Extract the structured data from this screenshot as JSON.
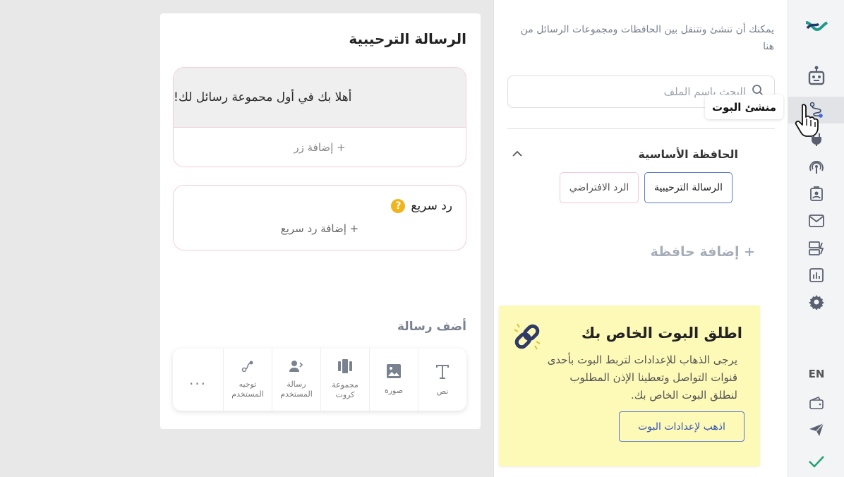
{
  "rail": {
    "items": [
      {
        "icon": "logo-icon"
      },
      {
        "icon": "robot-icon"
      },
      {
        "icon": "bot-builder-icon",
        "active": true
      },
      {
        "icon": "plug-icon"
      },
      {
        "icon": "broadcast-icon"
      },
      {
        "icon": "contacts-icon"
      },
      {
        "icon": "mail-icon"
      },
      {
        "icon": "ads-icon"
      },
      {
        "icon": "analytics-icon"
      },
      {
        "icon": "gear-icon"
      }
    ],
    "lang": "EN",
    "bottom": [
      {
        "icon": "wallet-icon"
      },
      {
        "icon": "send-icon"
      },
      {
        "icon": "check-icon"
      }
    ],
    "tooltip": "منشئ البوت"
  },
  "sidebar": {
    "description": "يمكنك أن تنشئ وتتنقل بين الحافظات ومجموعات الرسائل من هنا",
    "search_placeholder": "البحث باسم الملف",
    "folder_title": "الحافظة الأساسية",
    "chips": [
      "الرسالة الترحيبية",
      "الرد الافتراضي"
    ],
    "add_folder": "+ إضافة حافظة",
    "launch": {
      "title": "اطلق البوت الخاص بك",
      "body": "يرجى الذهاب للإعدادات لتربط البوت بأحدى قنوات التواصل وتعطينا الإذن المطلوب لنطلق البوت الخاص بك.",
      "button": "اذهب لإعدادات البوت"
    }
  },
  "editor": {
    "title": "الرسالة الترحيبية",
    "message_text": "أهلا بك في أول محموعة رسائل لك!",
    "add_button": "+ إضافة زر",
    "quick_reply_label": "رد سريع",
    "help_glyph": "?",
    "add_quick_reply": "+ إضافة رد سريع",
    "add_message_title": "أضف رسالة",
    "tools": [
      {
        "icon": "text-icon",
        "label": "نص"
      },
      {
        "icon": "image-icon",
        "label": "صورة"
      },
      {
        "icon": "cards-icon",
        "label": "مجموعة كروت"
      },
      {
        "icon": "user-message-icon",
        "label": "رسالة المستخدم"
      },
      {
        "icon": "route-icon",
        "label": "توجيه المستخدم"
      },
      {
        "icon": "more-icon",
        "label": "..."
      }
    ]
  }
}
